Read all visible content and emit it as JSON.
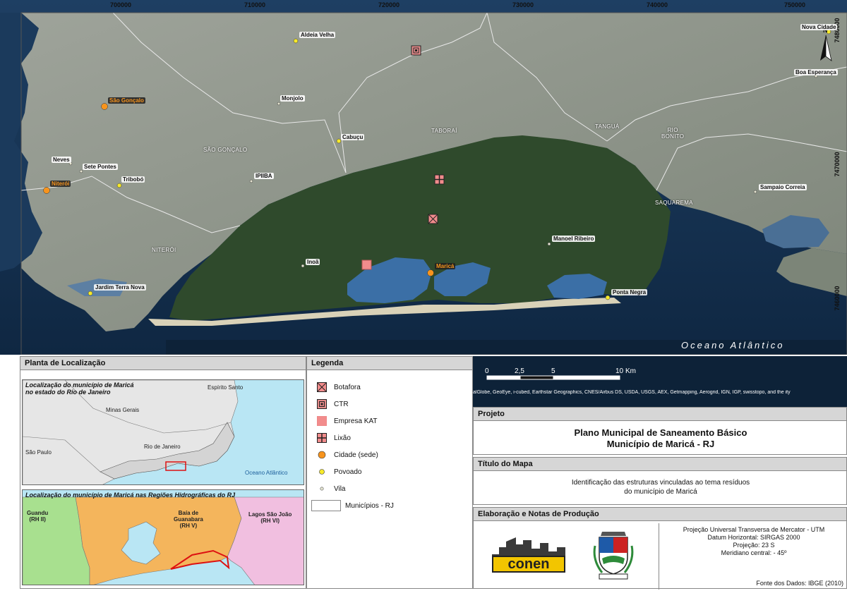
{
  "map": {
    "coords_top": [
      "700000",
      "710000",
      "720000",
      "730000",
      "740000",
      "750000"
    ],
    "coords_right": [
      "7480000",
      "7470000",
      "7460000"
    ],
    "municipalities": [
      {
        "id": "sao-goncalo",
        "label": "SÃO GONÇALO"
      },
      {
        "id": "itaborai",
        "label": "TABORAÍ"
      },
      {
        "id": "tangua",
        "label": "TANGUÁ"
      },
      {
        "id": "rio-bonito",
        "label": "RIO\nBONITO"
      },
      {
        "id": "saquarema",
        "label": "SAQUAREMA"
      },
      {
        "id": "niteroi",
        "label": "NITERÓI"
      }
    ],
    "places": [
      {
        "id": "aldeia-velha",
        "label": "Aldeia Velha",
        "type": "povoado"
      },
      {
        "id": "nova-cidade",
        "label": "Nova Cidade",
        "type": "povoado"
      },
      {
        "id": "boa-esperanca",
        "label": "Boa Esperança",
        "type": "vila"
      },
      {
        "id": "sao-goncalo-sede",
        "label": "São Gonçalo",
        "type": "sede"
      },
      {
        "id": "monjolo",
        "label": "Monjolo",
        "type": "vila"
      },
      {
        "id": "cabucu",
        "label": "Cabuçu",
        "type": "povoado"
      },
      {
        "id": "neves",
        "label": "Neves",
        "type": "vila"
      },
      {
        "id": "sete-pontes",
        "label": "Sete Pontes",
        "type": "vila"
      },
      {
        "id": "niteroi-sede",
        "label": "Niterói",
        "type": "sede"
      },
      {
        "id": "tribobo",
        "label": "Tribobó",
        "type": "povoado"
      },
      {
        "id": "ipiiba",
        "label": "IPIIBA",
        "type": "vila"
      },
      {
        "id": "sampaio-correia",
        "label": "Sampaio Correia",
        "type": "vila"
      },
      {
        "id": "manoel-ribeiro",
        "label": "Manoel Ribeiro",
        "type": "vila"
      },
      {
        "id": "inoa",
        "label": "Inoã",
        "type": "vila"
      },
      {
        "id": "marica-sede",
        "label": "Maricá",
        "type": "sede"
      },
      {
        "id": "jardim-terra-nova",
        "label": "Jardim Terra Nova",
        "type": "povoado"
      },
      {
        "id": "ponta-negra",
        "label": "Ponta Negra",
        "type": "povoado"
      }
    ],
    "ocean_label": "Oceano Atlântico",
    "north_label": "N",
    "scale": {
      "ticks": [
        "0",
        "2,5",
        "5",
        "10"
      ],
      "unit": "Km"
    },
    "attribution": "alGlobe, GeoEye, i-cubed, Earthstar Geographics, CNES/Airbus DS, USDA, USGS, AEX, Getmapping, Aerogrid, IGN, IGP, swisstopo, and the ity"
  },
  "location": {
    "title": "Planta de Localização",
    "inset1": {
      "title": "Localização do município de Maricá\nno estado do Rio de Janeiro",
      "labels": [
        "Espírito Santo",
        "Minas Gerais",
        "São Paulo",
        "Rio de Janeiro",
        "Oceano Atlântico"
      ]
    },
    "inset2": {
      "title": "Localização do município de Maricá nas Regiões Hidrográficas do  RJ",
      "regions": [
        {
          "name": "Guandu",
          "code": "(RH II)"
        },
        {
          "name": "Baía de\nGuanabara",
          "code": "(RH V)"
        },
        {
          "name": "Lagos São João",
          "code": "(RH VI)"
        }
      ]
    }
  },
  "legend": {
    "title": "Legenda",
    "items": [
      {
        "id": "botafora",
        "label": "Botafora"
      },
      {
        "id": "ctr",
        "label": "CTR"
      },
      {
        "id": "empresa-kat",
        "label": "Empresa KAT"
      },
      {
        "id": "lixao",
        "label": "Lixão"
      },
      {
        "id": "cidade",
        "label": "Cidade (sede)"
      },
      {
        "id": "povoado",
        "label": "Povoado"
      },
      {
        "id": "vila",
        "label": "Vila"
      },
      {
        "id": "municipios",
        "label": "Municípios - RJ"
      }
    ]
  },
  "projeto": {
    "head": "Projeto",
    "line1": "Plano Municipal de Saneamento Básico",
    "line2": "Município de Maricá - RJ"
  },
  "titulo": {
    "head": "Título do Mapa",
    "line1": "Identificação das estruturas vinculadas ao tema resíduos",
    "line2": "do município de Maricá"
  },
  "elaboracao": {
    "head": "Elaboração e Notas de Produção",
    "logo_text": "conen",
    "notes": [
      "Projeção Universal Transversa de Mercator - UTM",
      "Datum Horizontal: SIRGAS 2000",
      "Projeção: 23 S",
      "Meridiano central: - 45º"
    ],
    "fonte": "Fonte dos Dados: IBGE (2010)"
  },
  "colors": {
    "forest": "#2f4a2c",
    "urban": "#8e948c",
    "water": "#16365a",
    "lagoon": "#3b6fa6",
    "rh_guandu": "#a8e08f",
    "rh_guanabara": "#f4b55c",
    "rh_lagos": "#f1bfe0",
    "ocean_inset": "#b9e6f4",
    "sede": "#f7941d",
    "povoado": "#f7ea2a"
  }
}
